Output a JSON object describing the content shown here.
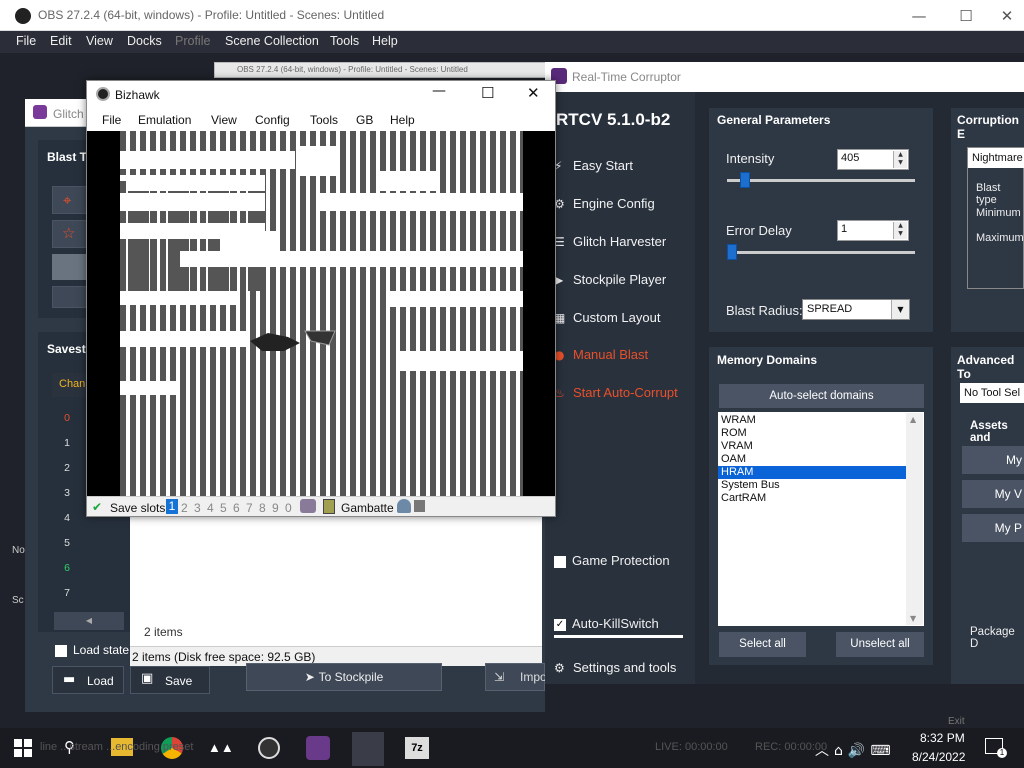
{
  "obs": {
    "title": "OBS 27.2.4 (64-bit, windows) - Profile: Untitled - Scenes: Untitled",
    "menu": [
      "File",
      "Edit",
      "View",
      "Docks",
      "Profile",
      "Scene Collection",
      "Tools",
      "Help"
    ],
    "ghost_title": "OBS 27.2.4 (64-bit, windows) - Profile: Untitled - Scenes: Untitled",
    "bottom_text": "line ...stream ...encoding preset",
    "live": "LIVE: 00:00:00",
    "rec": "REC: 00:00:00",
    "exit": "Exit",
    "no": "No",
    "sc": "Sc"
  },
  "glitch": {
    "title": "Glitch",
    "blast_tools_label": "Blast To",
    "savestates_label": "Savesta",
    "chan_label": "Chan",
    "slots": [
      "0",
      "1",
      "2",
      "3",
      "4",
      "5",
      "6",
      "7"
    ],
    "load_state_label": "Load state",
    "load_label": "Load",
    "save_label": "Save"
  },
  "stockpile": {
    "items_count": "2 items",
    "status": "2 items (Disk free space: 92.5 GB)",
    "to_stockpile": "To Stockpile",
    "import": "Impo"
  },
  "bizhawk": {
    "title": "Bizhawk",
    "menu": [
      "File",
      "Emulation",
      "View",
      "Config",
      "Tools",
      "GB",
      "Help"
    ],
    "save_slots_label": "Save slots",
    "slots": [
      "1",
      "2",
      "3",
      "4",
      "5",
      "6",
      "7",
      "8",
      "9",
      "0"
    ],
    "active_slot": "1",
    "core": "Gambatte"
  },
  "rtcv": {
    "title": "Real-Time Corruptor",
    "version": "RTCV 5.1.0-b2",
    "nav": [
      {
        "label": "Easy Start",
        "icon": "lightning-icon"
      },
      {
        "label": "Engine Config",
        "icon": "gear-icon"
      },
      {
        "label": "Glitch Harvester",
        "icon": "layers-icon"
      },
      {
        "label": "Stockpile Player",
        "icon": "play-icon"
      },
      {
        "label": "Custom Layout",
        "icon": "grid-icon"
      },
      {
        "label": "Manual Blast",
        "icon": "bomb-icon"
      },
      {
        "label": "Start Auto-Corrupt",
        "icon": "fire-icon"
      }
    ],
    "game_protection_label": "Game Protection",
    "auto_killswitch_label": "Auto-KillSwitch",
    "settings_label": "Settings and tools",
    "general": {
      "header": "General Parameters",
      "intensity_label": "Intensity",
      "intensity_value": "405",
      "error_delay_label": "Error Delay",
      "error_delay_value": "1",
      "blast_radius_label": "Blast Radius:",
      "blast_radius_value": "SPREAD"
    },
    "memory": {
      "header": "Memory Domains",
      "auto_select_label": "Auto-select domains",
      "domains": [
        "WRAM",
        "ROM",
        "VRAM",
        "OAM",
        "HRAM",
        "System Bus",
        "CartRAM"
      ],
      "selected_domain": "HRAM",
      "select_all_label": "Select all",
      "unselect_all_label": "Unselect all"
    },
    "corruption_engine": {
      "header": "Corruption E",
      "engine_value": "Nightmare",
      "blast_type_label": "Blast type",
      "minimum_label": "Minimum",
      "maximum_label": "Maximum"
    },
    "advanced_tools": {
      "header": "Advanced To",
      "tool_select_value": "No Tool Sel",
      "assets_label": "Assets and",
      "buttons": [
        "My",
        "My V",
        "My P"
      ],
      "package_label": "Package D"
    }
  },
  "taskbar": {
    "time": "8:32 PM",
    "date": "8/24/2022",
    "notification_count": "1"
  },
  "colors": {
    "accent_blue": "#1d6fcf",
    "danger_orange": "#e8502a",
    "obs_dark": "#1f222a",
    "rtcv_panel": "#2e3744"
  }
}
